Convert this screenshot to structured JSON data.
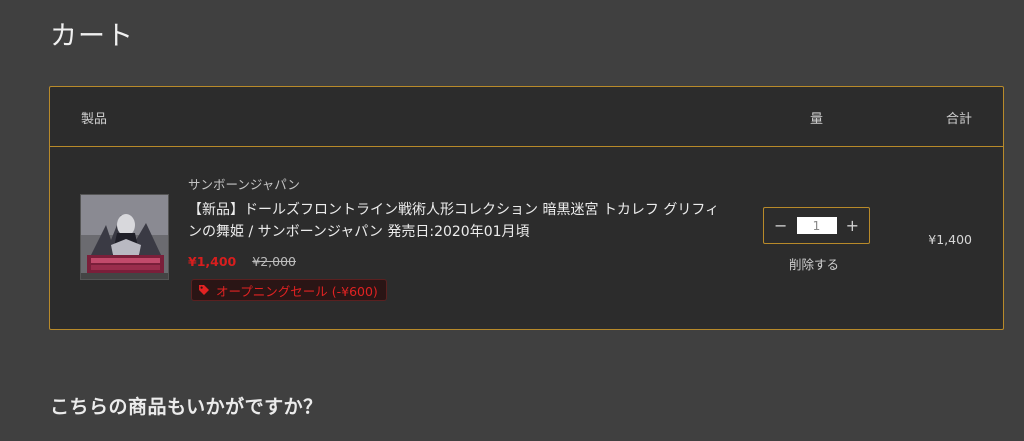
{
  "page": {
    "title": "カート"
  },
  "cart": {
    "headers": {
      "product": "製品",
      "quantity": "量",
      "total": "合計"
    },
    "item": {
      "vendor": "サンボーンジャパン",
      "title": "【新品】ドールズフロントライン戦術人形コレクション 暗黒迷宮 トカレフ グリフィンの舞姫 / サンボーンジャパン 発売日:2020年01月頃",
      "sale_price": "¥1,400",
      "original_price": "¥2,000",
      "discount_label": "オープニングセール (-¥600)",
      "quantity": "1",
      "remove_label": "削除する",
      "line_total": "¥1,400"
    },
    "controls": {
      "decrement": "−",
      "increment": "+"
    }
  },
  "recommendations": {
    "title": "こちらの商品もいかがですか？"
  },
  "colors": {
    "background": "#404040",
    "panel": "#2c2c2c",
    "accent_border": "#b88a2a",
    "sale_red": "#d81e1e"
  },
  "icons": {
    "discount": "tag-icon"
  }
}
